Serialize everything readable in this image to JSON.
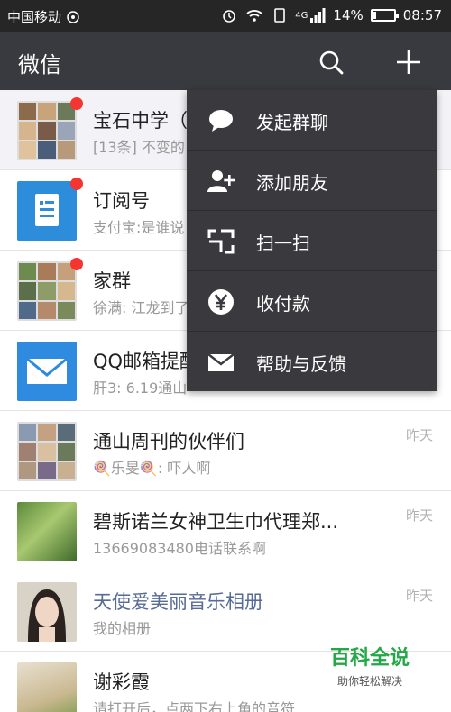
{
  "status_bar": {
    "carrier": "中国移动",
    "network": "4G",
    "battery_percent": "14%",
    "battery_level": 0.14,
    "time": "08:57"
  },
  "header": {
    "title": "微信",
    "search_icon": "search-icon",
    "add_icon": "plus-icon"
  },
  "chats": [
    {
      "name": "宝石中学（",
      "preview": "[13条] 不变的",
      "time": "",
      "unread_dot": true,
      "avatar": "group-grid"
    },
    {
      "name": "订阅号",
      "preview": "支付宝:是谁说",
      "time": "",
      "unread_dot": true,
      "avatar": "subscription-icon"
    },
    {
      "name": "家群",
      "preview": "徐满: 江龙到了",
      "time": "",
      "unread_dot": true,
      "avatar": "group-grid"
    },
    {
      "name": "QQ邮箱提醒",
      "preview": "肝3: 6.19通山",
      "time": "",
      "unread_dot": false,
      "avatar": "mail-icon"
    },
    {
      "name": "通山周刊的伙伴们",
      "preview": "🍭乐旻🍭: 吓人啊",
      "time": "昨天",
      "unread_dot": false,
      "avatar": "group-grid"
    },
    {
      "name": "碧斯诺兰女神卫生巾代理郑...",
      "preview": "13669083480电话联系啊",
      "time": "昨天",
      "unread_dot": false,
      "avatar": "plant-photo"
    },
    {
      "name": "天使爱美丽音乐相册",
      "preview": "我的相册",
      "time": "昨天",
      "unread_dot": false,
      "avatar": "portrait-photo"
    },
    {
      "name": "谢彩霞",
      "preview": "请打开后，点两下右上角的音符",
      "time": "",
      "unread_dot": false,
      "avatar": "classroom-photo"
    }
  ],
  "menu": [
    {
      "label": "发起群聊",
      "icon": "chat-bubble-icon"
    },
    {
      "label": "添加朋友",
      "icon": "add-friend-icon"
    },
    {
      "label": "扫一扫",
      "icon": "scan-icon"
    },
    {
      "label": "收付款",
      "icon": "yuan-icon"
    },
    {
      "label": "帮助与反馈",
      "icon": "mail-icon"
    }
  ],
  "watermark": {
    "brand": "百科全说",
    "slogan": "助你轻松解决"
  },
  "colors": {
    "header_bg": "#393a3f",
    "menu_bg": "#3a3a3e",
    "unread_dot": "#f43530",
    "link_blue": "#576b95",
    "watermark_green": "#22a845"
  }
}
